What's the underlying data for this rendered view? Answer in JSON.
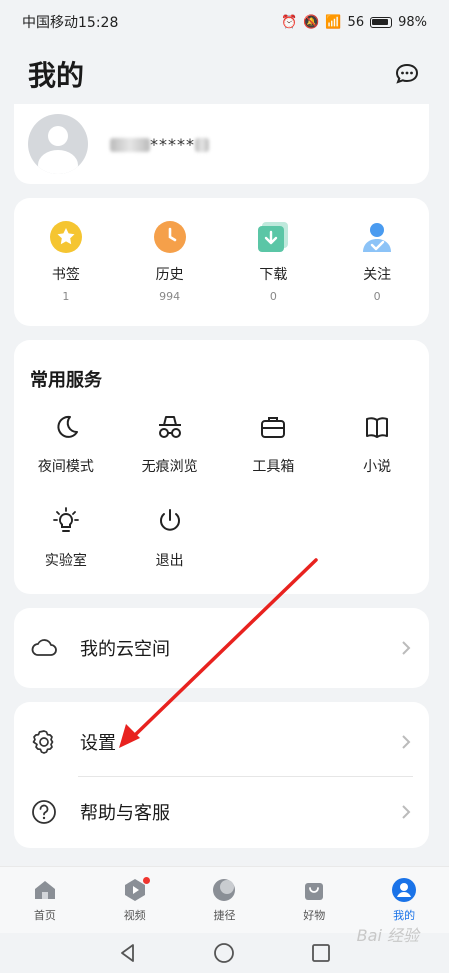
{
  "status_bar": {
    "carrier_time": "中国移动15:28",
    "network": "56",
    "battery_percent": "98%"
  },
  "header": {
    "title": "我的",
    "message_icon": "chat-bubble-icon"
  },
  "profile": {
    "username": "*****"
  },
  "stats": [
    {
      "label": "书签",
      "count": "1",
      "icon": "bookmark-star-icon",
      "color": "#f5c531"
    },
    {
      "label": "历史",
      "count": "994",
      "icon": "history-clock-icon",
      "color": "#f5a04a"
    },
    {
      "label": "下载",
      "count": "0",
      "icon": "download-icon",
      "color": "#5bc6a6"
    },
    {
      "label": "关注",
      "count": "0",
      "icon": "follow-user-icon",
      "color": "#4a9bf0"
    }
  ],
  "services": {
    "title": "常用服务",
    "items": [
      {
        "label": "夜间模式",
        "icon": "moon-icon"
      },
      {
        "label": "无痕浏览",
        "icon": "incognito-icon"
      },
      {
        "label": "工具箱",
        "icon": "toolbox-icon"
      },
      {
        "label": "小说",
        "icon": "book-icon"
      },
      {
        "label": "实验室",
        "icon": "lightbulb-icon"
      },
      {
        "label": "退出",
        "icon": "power-icon"
      }
    ]
  },
  "cloud": {
    "label": "我的云空间"
  },
  "settings": {
    "label": "设置"
  },
  "help": {
    "label": "帮助与客服"
  },
  "bottom_nav": {
    "items": [
      {
        "label": "首页",
        "icon": "home-icon"
      },
      {
        "label": "视频",
        "icon": "video-icon"
      },
      {
        "label": "捷径",
        "icon": "shortcut-icon"
      },
      {
        "label": "好物",
        "icon": "shopping-bag-icon"
      },
      {
        "label": "我的",
        "icon": "profile-icon"
      }
    ],
    "active_index": 4
  },
  "watermark": "Bai 经验",
  "colors": {
    "accent": "#1a73e8",
    "arrow": "#e8221f",
    "background": "#f1f3f5"
  }
}
